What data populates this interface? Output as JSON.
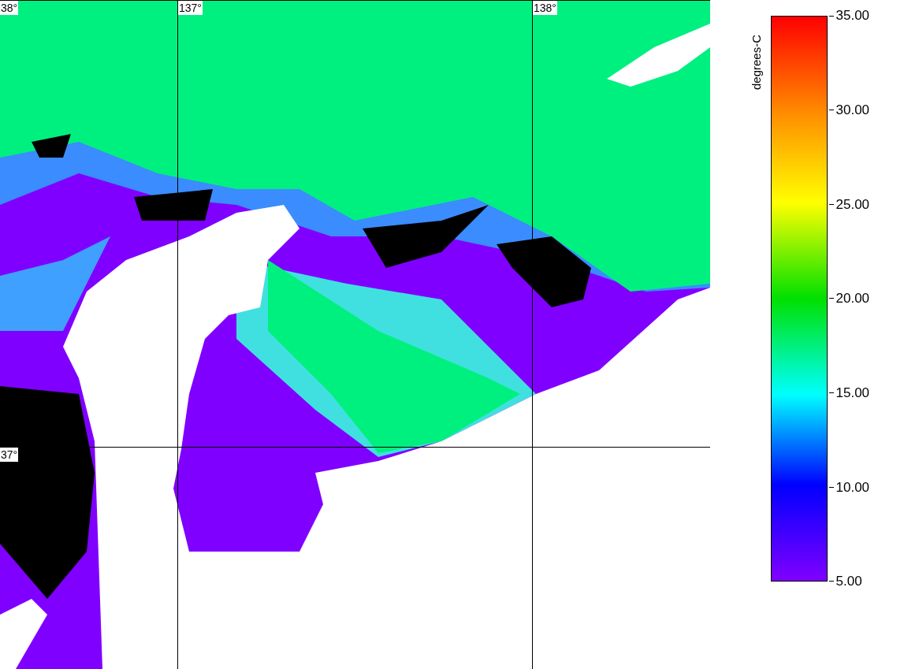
{
  "map": {
    "lat_labels": [
      "38°",
      "37°"
    ],
    "lon_labels": [
      "137°",
      "138°"
    ]
  },
  "colorbar": {
    "title": "degrees-C",
    "ticks": [
      "35.00",
      "30.00",
      "25.00",
      "20.00",
      "15.00",
      "10.00",
      "5.00"
    ]
  }
}
